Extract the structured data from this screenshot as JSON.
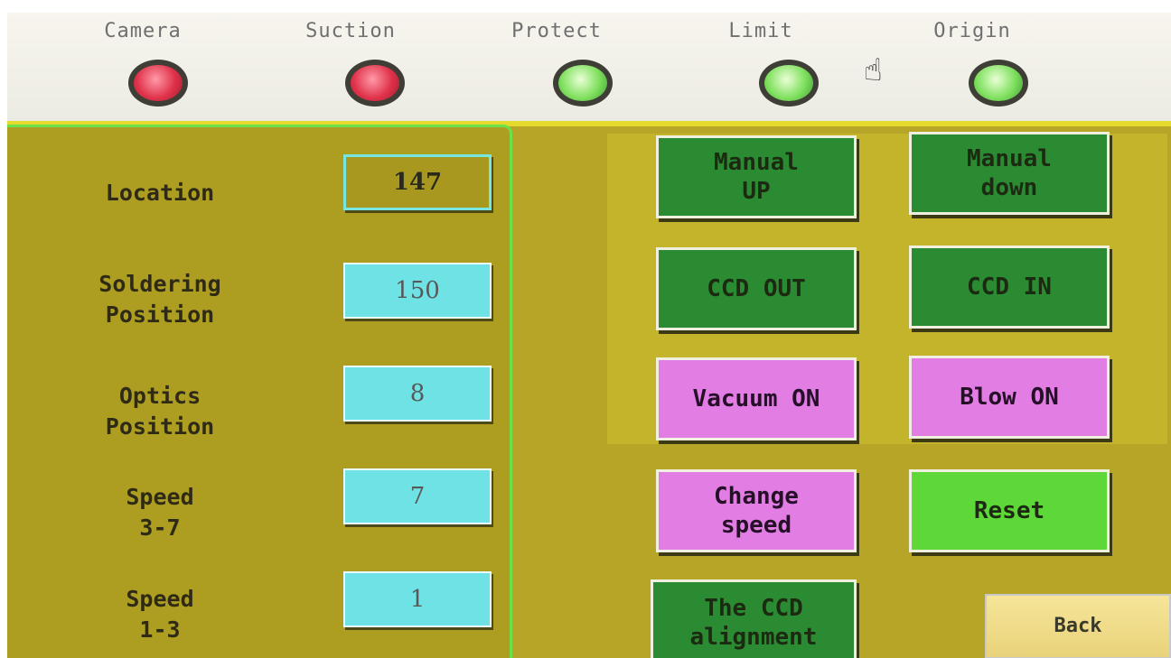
{
  "indicators": [
    {
      "label": "Camera",
      "state": "red"
    },
    {
      "label": "Suction",
      "state": "red"
    },
    {
      "label": "Protect",
      "state": "green"
    },
    {
      "label": "Limit",
      "state": "green"
    },
    {
      "label": "Origin",
      "state": "green"
    }
  ],
  "cursor_icon": "☝",
  "params": [
    {
      "label": "Location",
      "value": "147"
    },
    {
      "label": "Soldering\nPosition",
      "value": "150"
    },
    {
      "label": "Optics\nPosition",
      "value": "8"
    },
    {
      "label": "Speed\n3-7",
      "value": "7"
    },
    {
      "label": "Speed\n1-3",
      "value": "1"
    }
  ],
  "buttons": {
    "manual_up": "Manual\nUP",
    "manual_down": "Manual\ndown",
    "ccd_out": "CCD OUT",
    "ccd_in": "CCD IN",
    "vacuum_on": "Vacuum ON",
    "blow_on": "Blow ON",
    "change_speed": "Change\nspeed",
    "reset": "Reset",
    "ccd_alignment": "The CCD\nalignment",
    "back": "Back"
  },
  "colors": {
    "panel": "#b6a526",
    "value_box": "#6fe2e6",
    "dark_green": "#2b8b33",
    "pink": "#e27de4",
    "lime": "#5ed838",
    "lamp_red": "#e0324a",
    "lamp_green": "#7fe05e"
  }
}
